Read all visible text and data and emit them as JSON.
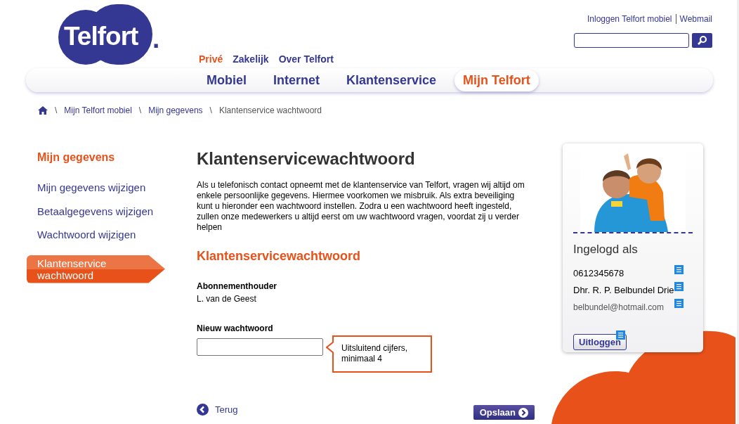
{
  "logo": {
    "text": "Telfort",
    "dot": "."
  },
  "top_links": [
    "Inloggen Telfort mobiel",
    "Webmail"
  ],
  "segments": [
    {
      "label": "Privé",
      "selected": true
    },
    {
      "label": "Zakelijk",
      "selected": false
    },
    {
      "label": "Over Telfort",
      "selected": false
    }
  ],
  "main_nav": [
    {
      "label": "Mobiel",
      "selected": false
    },
    {
      "label": "Internet",
      "selected": false
    },
    {
      "label": "Klantenservice",
      "selected": false
    },
    {
      "label": "Mijn Telfort",
      "selected": true
    }
  ],
  "breadcrumb": {
    "separator": "\\",
    "items": [
      "Mijn Telfort mobiel",
      "Mijn gegevens",
      "Klantenservice wachtwoord"
    ]
  },
  "sidebar": {
    "title": "Mijn gegevens",
    "items": [
      {
        "label": "Mijn gegevens wijzigen",
        "selected": false
      },
      {
        "label": "Betaalgegevens wijzigen",
        "selected": false
      },
      {
        "label": "Wachtwoord wijzigen",
        "selected": false
      },
      {
        "label": "Klantenservice wachtwoord",
        "selected": true
      }
    ]
  },
  "main": {
    "title": "Klantenservicewachtwoord",
    "intro": "Als u telefonisch contact opneemt met de klantenservice van Telfort, vragen wij altijd om enkele persoonlijke gegevens. Hiermee voorkomen we misbruik. Als extra beveiliging kunt u hieronder een wachtwoord instellen. Zodra u een wachtwoord heeft ingesteld, zullen onze medewerkers u altijd eerst om uw wachtwoord vragen, voordat zij u verder helpen",
    "section_title": "Klantenservicewachtwoord",
    "holder_label": "Abonnementhouder",
    "holder_value": "L. van de Geest",
    "password_label": "Nieuw wachtwoord",
    "password_hint": "Uitsluitend cijfers, minimaal 4",
    "back": "Terug",
    "save": "Opslaan"
  },
  "account": {
    "heading": "Ingelogd als",
    "lines": [
      {
        "text": "0612345678",
        "kind": "phone"
      },
      {
        "text": "Dhr. R. P. Belbundel Drie",
        "kind": "name"
      },
      {
        "text": "belbundel@hotmail.com",
        "kind": "email"
      }
    ],
    "logout": "Uitloggen"
  }
}
